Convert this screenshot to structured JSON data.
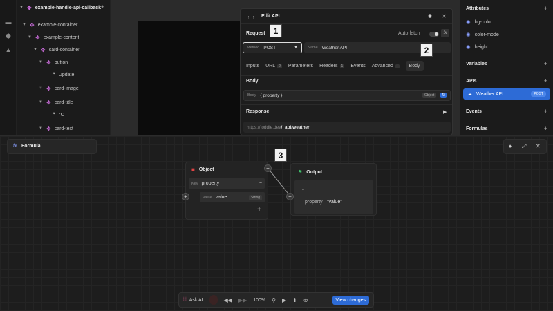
{
  "tree": {
    "root": "example-handle-api-callback",
    "items": [
      {
        "label": "example-container",
        "type": "element"
      },
      {
        "label": "example-content",
        "type": "element"
      },
      {
        "label": "card-container",
        "type": "element"
      },
      {
        "label": "button",
        "type": "element"
      },
      {
        "label": "Update",
        "type": "text"
      },
      {
        "label": "card-image",
        "type": "element"
      },
      {
        "label": "card-title",
        "type": "element"
      },
      {
        "label": "°C",
        "type": "text"
      },
      {
        "label": "card-text",
        "type": "element"
      }
    ]
  },
  "right_panel": {
    "attributes_heading": "Attributes",
    "attributes": [
      "bg-color",
      "color-mode",
      "height"
    ],
    "variables_heading": "Variables",
    "apis_heading": "APIs",
    "api_item": {
      "name": "Weather API",
      "method": "POST"
    },
    "events_heading": "Events",
    "formulas_heading": "Formulas"
  },
  "dialog": {
    "title": "Edit API",
    "request_label": "Request",
    "auto_fetch_label": "Auto fetch",
    "method_label": "Method",
    "method_value": "POST",
    "name_label": "Name",
    "name_value": "Weather API",
    "tabs": [
      {
        "label": "Inputs",
        "count": ""
      },
      {
        "label": "URL",
        "count": "2"
      },
      {
        "label": "Parameters",
        "count": ""
      },
      {
        "label": "Headers",
        "count": "1"
      },
      {
        "label": "Events",
        "count": ""
      },
      {
        "label": "Advanced",
        "count": ""
      },
      {
        "label": "Body",
        "count": ""
      }
    ],
    "body_heading": "Body",
    "body_field_label": "Body",
    "body_value": "{ property }",
    "body_type": "Object",
    "response_heading": "Response",
    "url_prefix": "https://toddle.dev",
    "url_path": "/_api/weather"
  },
  "callouts": [
    "1",
    "2",
    "3"
  ],
  "formula": {
    "title": "Formula",
    "object_node": {
      "title": "Object",
      "key_label": "Key",
      "key_value": "property",
      "value_label": "Value",
      "value_value": "value",
      "value_type": "String"
    },
    "output_node": {
      "title": "Output",
      "key": "property",
      "value": "\"value\""
    }
  },
  "toolbar": {
    "ask_ai": "Ask AI",
    "zoom": "100%",
    "view_changes": "View changes"
  },
  "colors": {
    "accent": "#2d6bd6",
    "element_icon": "#c86bd8",
    "attr_icon": "#8aa0ff"
  }
}
